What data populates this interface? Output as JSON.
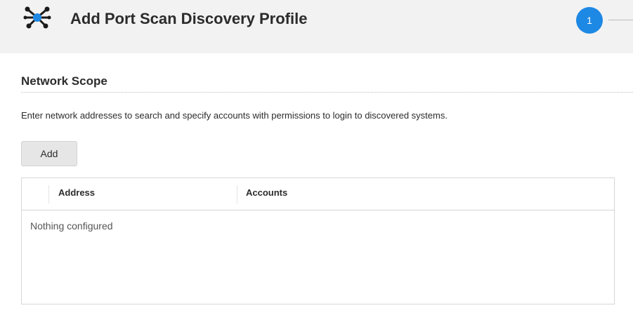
{
  "header": {
    "title": "Add Port Scan Discovery Profile",
    "icon": "network-discovery-icon",
    "step_number": "1",
    "accent_color": "#1e88e5"
  },
  "section": {
    "title": "Network Scope",
    "description": "Enter network addresses to search and specify accounts with permissions to login to discovered systems."
  },
  "actions": {
    "add_label": "Add"
  },
  "table": {
    "columns": [
      "Address",
      "Accounts"
    ],
    "empty_text": "Nothing configured"
  }
}
